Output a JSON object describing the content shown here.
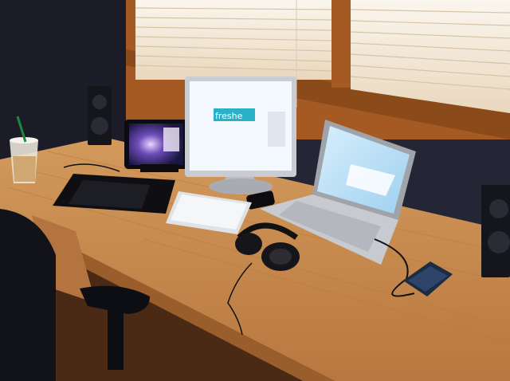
{
  "scene": {
    "description_label": "",
    "monitor_screen_text": "freshe",
    "colors": {
      "wall": "#262838",
      "window_frame": "#a45a22",
      "blinds": "#f4ead8",
      "desk": "#c8894c",
      "desk_dark": "#9a5e2c",
      "screen_glow": "#eef6ff",
      "laptop_screen": "#bfe2f6",
      "chair": "#14161e",
      "floor": "#5a3418"
    },
    "objects": [
      "window-blinds-left",
      "window-blinds-right",
      "speaker-left",
      "speaker-right",
      "starbucks-cup",
      "ipad",
      "graphics-tablet",
      "external-monitor",
      "wireless-keyboard",
      "iphone",
      "macbook-pro",
      "headphones",
      "external-hard-drive",
      "office-chair"
    ]
  }
}
